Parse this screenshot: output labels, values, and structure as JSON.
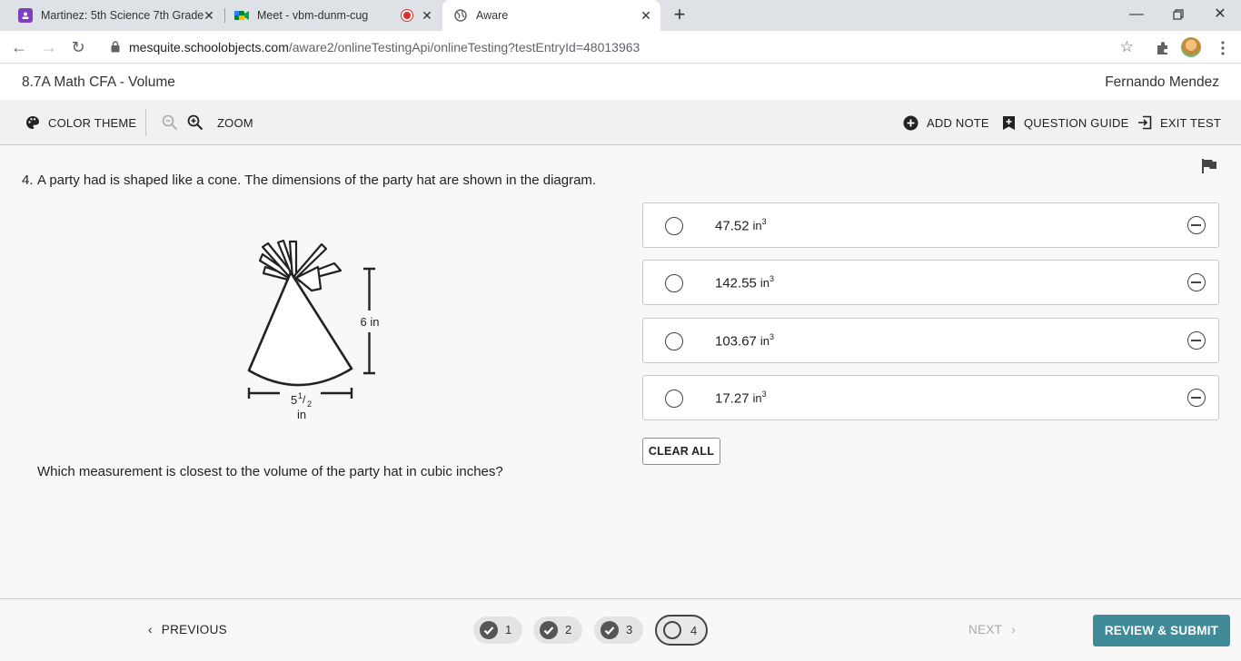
{
  "browser": {
    "tabs": [
      {
        "title": "Martinez: 5th Science 7th Grade",
        "icon": "classroom-icon"
      },
      {
        "title": "Meet - vbm-dunm-cug",
        "icon": "meet-icon",
        "recording": true
      },
      {
        "title": "Aware",
        "icon": "globe-icon",
        "active": true
      }
    ],
    "url_host": "mesquite.schoolobjects.com",
    "url_path": "/aware2/onlineTestingApi/onlineTesting?testEntryId=48013963"
  },
  "app": {
    "title": "8.7A Math CFA - Volume",
    "user": "Fernando Mendez"
  },
  "toolbar": {
    "color_theme": "COLOR THEME",
    "zoom": "ZOOM",
    "add_note": "ADD NOTE",
    "question_guide": "QUESTION GUIDE",
    "exit_test": "EXIT TEST"
  },
  "question": {
    "number": "4.",
    "text": "A party had is shaped like a cone. The dimensions of the party hat are shown in the diagram.",
    "ask": "Which measurement is closest to the volume of the party hat in cubic inches?",
    "diagram": {
      "height_label": "6 in",
      "base_whole": "5",
      "base_num": "1",
      "base_den": "2",
      "base_unit": "in"
    }
  },
  "options": [
    {
      "value": "47.52",
      "unit": "in",
      "exp": "3"
    },
    {
      "value": "142.55",
      "unit": "in",
      "exp": "3"
    },
    {
      "value": "103.67",
      "unit": "in",
      "exp": "3"
    },
    {
      "value": "17.27",
      "unit": "in",
      "exp": "3"
    }
  ],
  "clear_all": "CLEAR ALL",
  "footer": {
    "previous": "PREVIOUS",
    "next": "NEXT",
    "review": "REVIEW & SUBMIT",
    "pages": [
      "1",
      "2",
      "3",
      "4"
    ]
  },
  "colors": {
    "accent": "#3f8b99"
  }
}
